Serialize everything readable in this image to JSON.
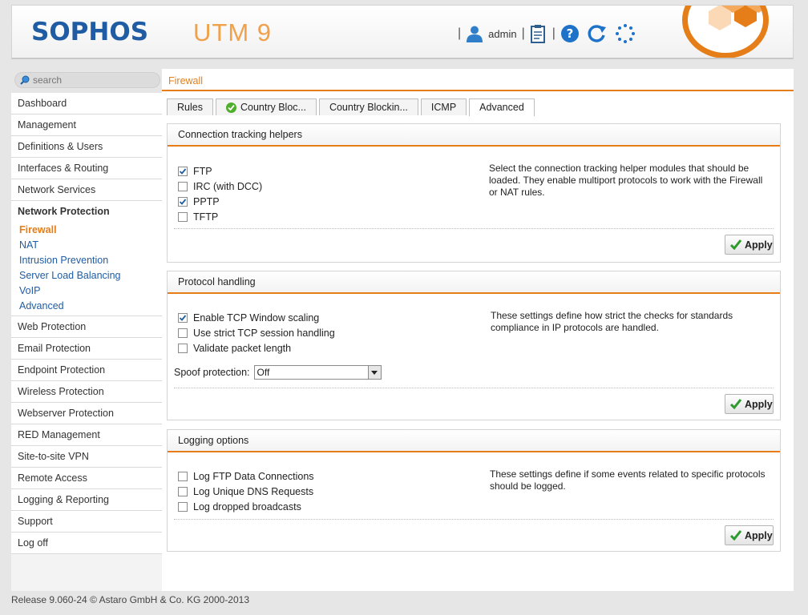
{
  "header": {
    "logo": "SOPHOS",
    "product": "UTM 9",
    "user": "admin",
    "sep": "|",
    "icons": [
      "user-icon",
      "clipboard-icon",
      "help-icon",
      "refresh-icon",
      "spinner-icon"
    ],
    "colors": {
      "brand": "#1f5ca3",
      "accent": "#e57e19",
      "product": "#f0a14c"
    }
  },
  "search": {
    "placeholder": "search"
  },
  "nav": {
    "items_top": [
      "Dashboard",
      "Management",
      "Definitions & Users",
      "Interfaces & Routing",
      "Network Services"
    ],
    "active": "Network Protection",
    "sub_items": [
      "Firewall",
      "NAT",
      "Intrusion Prevention",
      "Server Load Balancing",
      "VoIP",
      "Advanced"
    ],
    "items_bottom": [
      "Web Protection",
      "Email Protection",
      "Endpoint Protection",
      "Wireless Protection",
      "Webserver Protection",
      "RED Management",
      "Site-to-site VPN",
      "Remote Access",
      "Logging & Reporting",
      "Support",
      "Log off"
    ]
  },
  "breadcrumb": "Firewall",
  "tabs": [
    "Rules",
    "Country Bloc...",
    "Country Blockin...",
    "ICMP",
    "Advanced"
  ],
  "panels": {
    "conn": {
      "title": "Connection tracking helpers",
      "options": [
        {
          "label": "FTP",
          "checked": true
        },
        {
          "label": "IRC (with DCC)",
          "checked": false
        },
        {
          "label": "PPTP",
          "checked": true
        },
        {
          "label": "TFTP",
          "checked": false
        }
      ],
      "desc": "Select the connection tracking helper modules that should be loaded. They enable multiport protocols to work with the Firewall or NAT rules.",
      "apply": "Apply"
    },
    "proto": {
      "title": "Protocol handling",
      "options": [
        {
          "label": "Enable TCP Window scaling",
          "checked": true
        },
        {
          "label": "Use strict TCP session handling",
          "checked": false
        },
        {
          "label": "Validate packet length",
          "checked": false
        }
      ],
      "spoof_label": "Spoof protection:",
      "spoof_value": "Off",
      "desc": "These settings define how strict the checks for standards compliance in IP protocols are handled.",
      "apply": "Apply"
    },
    "logging": {
      "title": "Logging options",
      "options": [
        {
          "label": "Log FTP Data Connections",
          "checked": false
        },
        {
          "label": "Log Unique DNS Requests",
          "checked": false
        },
        {
          "label": "Log dropped broadcasts",
          "checked": false
        }
      ],
      "desc": "These settings define if some events related to specific protocols should be logged.",
      "apply": "Apply"
    }
  },
  "footer": "Release 9.060-24  © Astaro GmbH & Co. KG 2000-2013"
}
